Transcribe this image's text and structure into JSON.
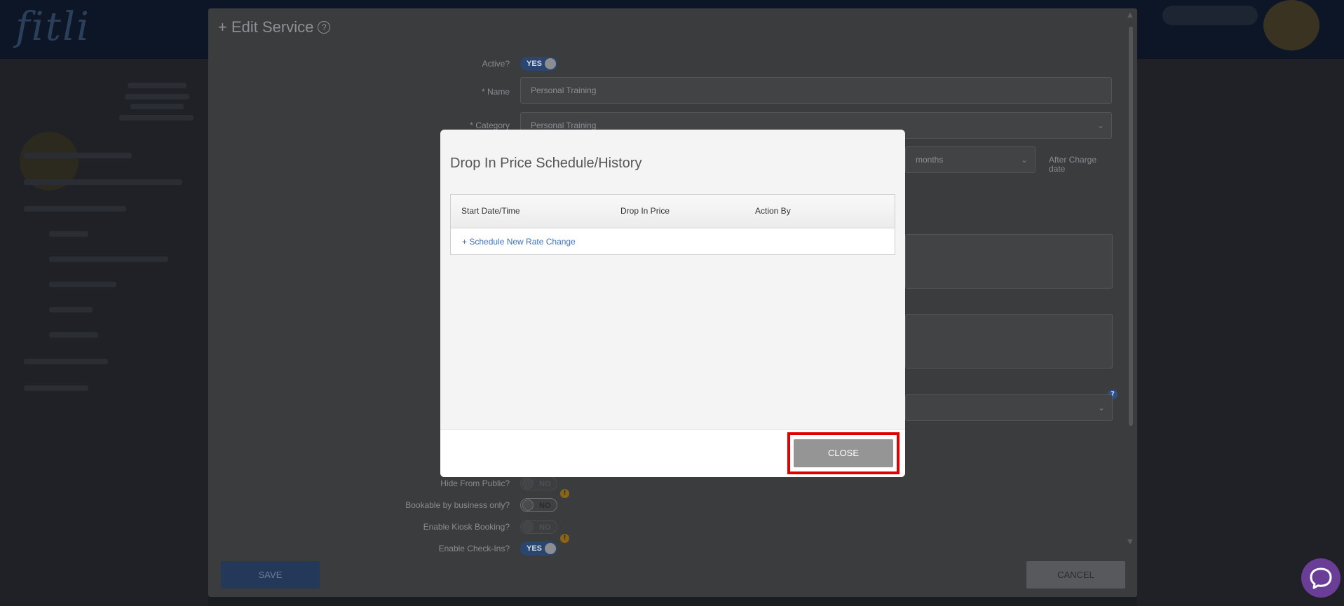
{
  "panel": {
    "title": "+ Edit Service",
    "help_glyph": "?",
    "fields": {
      "active_label": "Active?",
      "active_value": "YES",
      "name_label": "* Name",
      "name_value": "Personal Training",
      "category_label": "* Category",
      "category_value": "Personal Training",
      "period_value": "months",
      "after_charge_label": "After Charge date",
      "hide_public_label": "Hide From Public?",
      "hide_public_value": "NO",
      "bookable_label": "Bookable by business only?",
      "bookable_value": "NO",
      "kiosk_label": "Enable Kiosk Booking?",
      "kiosk_value": "NO",
      "checkins_label": "Enable Check-Ins?",
      "checkins_value": "YES"
    },
    "save_label": "SAVE",
    "cancel_label": "CANCEL"
  },
  "modal": {
    "title": "Drop In Price Schedule/History",
    "columns": [
      "Start Date/Time",
      "Drop In Price",
      "Action By"
    ],
    "schedule_link": "+ Schedule New Rate Change",
    "close_label": "CLOSE"
  },
  "colors": {
    "highlight": "#e00000",
    "link": "#3e72b9",
    "close_button": "#959595",
    "chat_widget": "#6a3d97"
  }
}
